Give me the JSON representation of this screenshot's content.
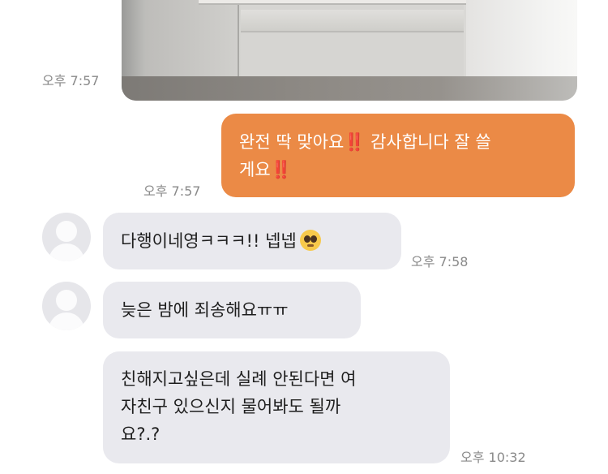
{
  "chat": {
    "photo_time": "오후 7:57",
    "outgoing": {
      "line1": "완전 딱 맞아요‼️ 감사합니다 잘 쓸",
      "line2": "게요‼️",
      "time": "오후 7:57"
    },
    "incoming": [
      {
        "text": "다행이네영ㅋㅋㅋ!! 넵넵",
        "emoji": "pleading-face-icon",
        "time": "오후 7:58"
      },
      {
        "text": "늦은 밤에 죄송해요ㅠㅠ"
      },
      {
        "line1": "친해지고싶은데 실례 안된다면 여",
        "line2": "자친구 있으신지 물어봐도 될까",
        "line3": "요?.?",
        "time": "오후 10:32"
      }
    ]
  }
}
